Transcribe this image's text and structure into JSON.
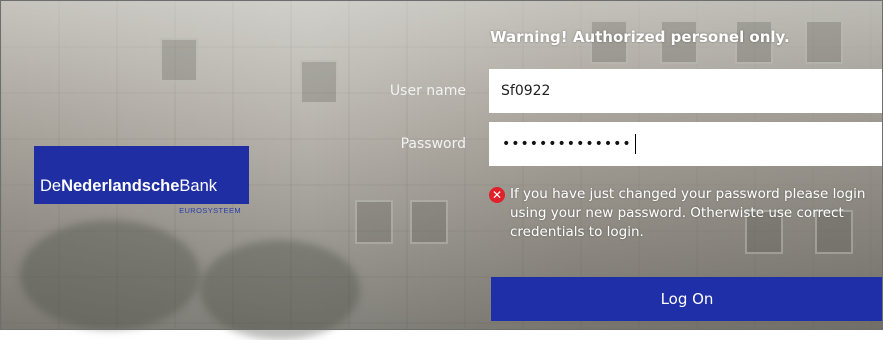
{
  "brand": {
    "name_prefix": "De",
    "name_bold": "Nederlandsche",
    "name_suffix": "Bank",
    "tagline": "EUROSYSTEEM",
    "color": "#1f2fa3"
  },
  "login": {
    "warning": "Warning! Authorized personel only.",
    "username_label": "User name",
    "username_value": "Sf0922",
    "password_label": "Password",
    "password_masked": "••••••••••••••",
    "error_message": "If you have just changed your password please login using your new password. Otherwiste use correct credentials to login.",
    "error_icon": "error-x-icon",
    "logon_label": "Log On"
  },
  "colors": {
    "accent": "#1e2fa8",
    "error": "#e0202a"
  }
}
